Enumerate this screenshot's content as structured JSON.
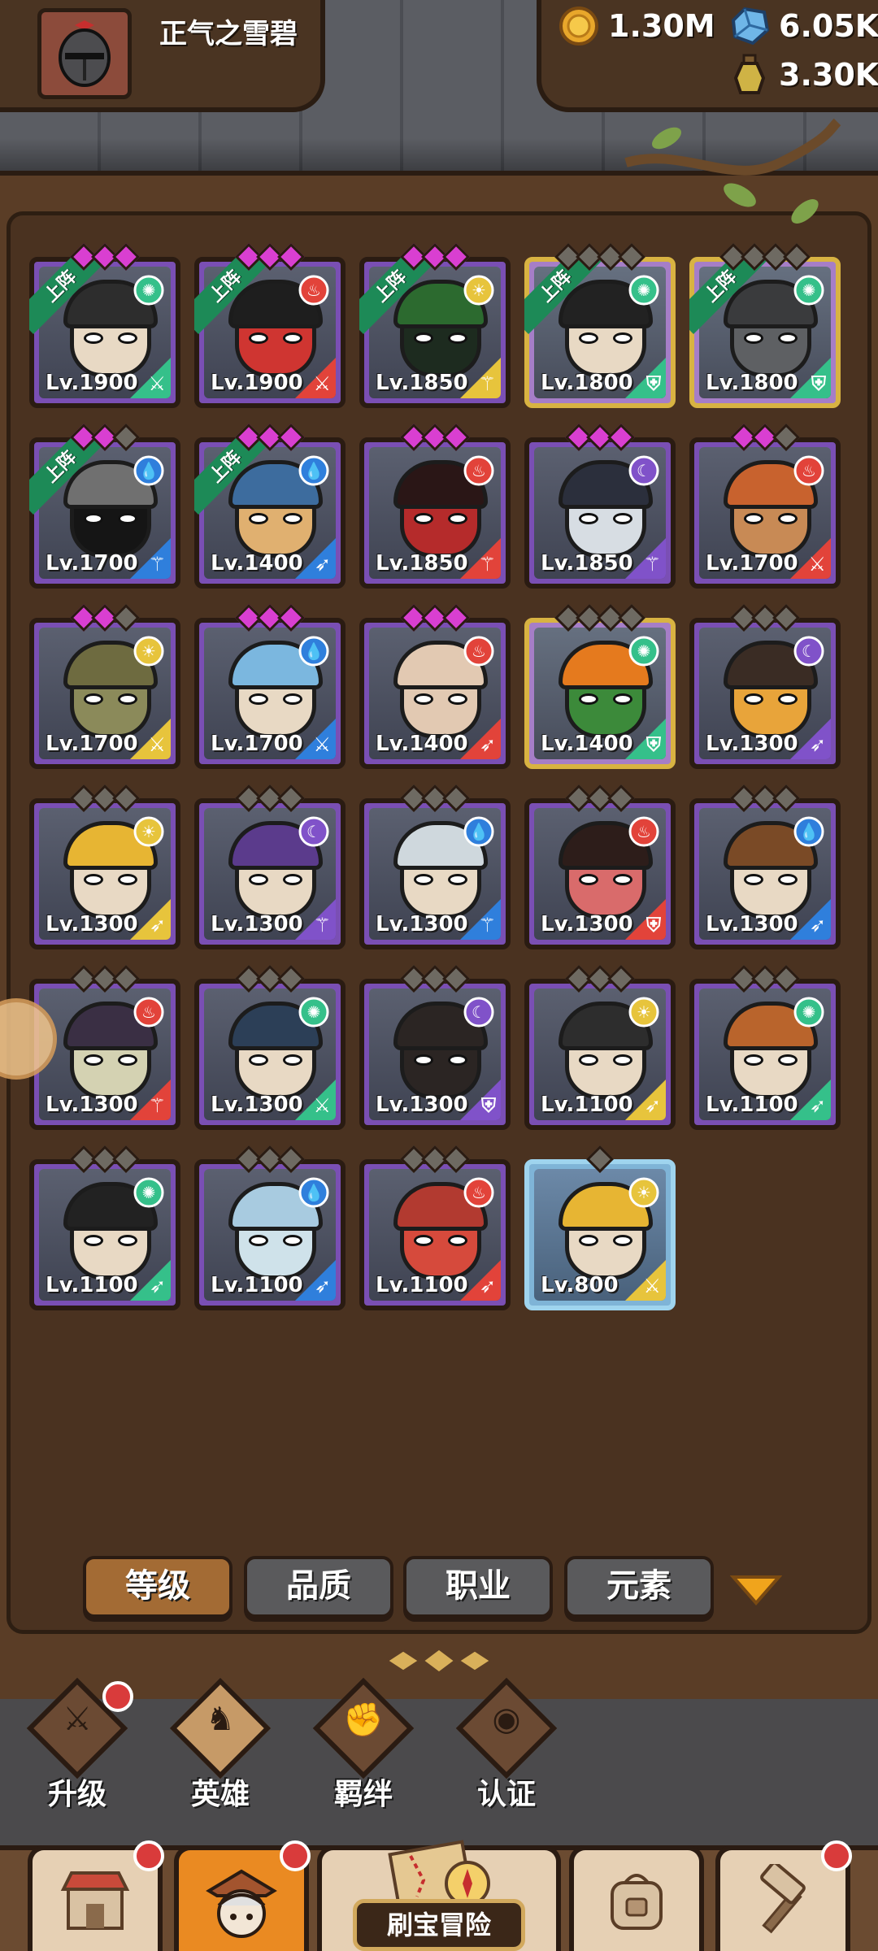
{
  "player": {
    "name": "正气之雪碧"
  },
  "resources": {
    "gold": "1.30M",
    "gems": "6.05K",
    "potion": "3.30K"
  },
  "ribbon_label": "上阵",
  "heroes": [
    {
      "level": "Lv.1900",
      "frame": "purple",
      "stars_on": 3,
      "stars_total": 3,
      "deployed": true,
      "element": "wind",
      "class": "sword",
      "face": "#e8d9c4",
      "hair": "#2d2d2d"
    },
    {
      "level": "Lv.1900",
      "frame": "purple",
      "stars_on": 3,
      "stars_total": 3,
      "deployed": true,
      "element": "fire",
      "class": "sword",
      "face": "#cf3531",
      "hair": "#1e1e1e"
    },
    {
      "level": "Lv.1850",
      "frame": "purple",
      "stars_on": 3,
      "stars_total": 3,
      "deployed": true,
      "element": "light",
      "class": "staff",
      "face": "#1d2b1f",
      "hair": "#2c6a2f"
    },
    {
      "level": "Lv.1800",
      "frame": "gold",
      "stars_on": 0,
      "stars_total": 4,
      "deployed": true,
      "element": "wind",
      "class": "shield",
      "face": "#e8d9c4",
      "hair": "#222"
    },
    {
      "level": "Lv.1800",
      "frame": "gold",
      "stars_on": 0,
      "stars_total": 4,
      "deployed": true,
      "element": "wind",
      "class": "shield",
      "face": "#5e6063",
      "hair": "#3a3b3d"
    },
    {
      "level": "Lv.1700",
      "frame": "purple",
      "stars_on": 2,
      "stars_total": 3,
      "deployed": true,
      "element": "water",
      "class": "staff",
      "face": "#151515",
      "hair": "#707070"
    },
    {
      "level": "Lv.1400",
      "frame": "purple",
      "stars_on": 3,
      "stars_total": 3,
      "deployed": true,
      "element": "water",
      "class": "bow",
      "face": "#e0b070",
      "hair": "#3d6c9e"
    },
    {
      "level": "Lv.1850",
      "frame": "purple",
      "stars_on": 3,
      "stars_total": 3,
      "deployed": false,
      "element": "fire",
      "class": "staff",
      "face": "#b52b2b",
      "hair": "#2a1616"
    },
    {
      "level": "Lv.1850",
      "frame": "purple",
      "stars_on": 3,
      "stars_total": 3,
      "deployed": false,
      "element": "dark",
      "class": "staff",
      "face": "#d7dde3",
      "hair": "#2b2f3c"
    },
    {
      "level": "Lv.1700",
      "frame": "purple",
      "stars_on": 2,
      "stars_total": 3,
      "deployed": false,
      "element": "fire",
      "class": "sword",
      "face": "#c88a55",
      "hair": "#c8622e"
    },
    {
      "level": "Lv.1700",
      "frame": "purple",
      "stars_on": 2,
      "stars_total": 3,
      "deployed": false,
      "element": "light",
      "class": "sword",
      "face": "#8b8a5a",
      "hair": "#6e6b40"
    },
    {
      "level": "Lv.1700",
      "frame": "purple",
      "stars_on": 3,
      "stars_total": 3,
      "deployed": false,
      "element": "water",
      "class": "sword",
      "face": "#e8d9c4",
      "hair": "#7bb7df"
    },
    {
      "level": "Lv.1400",
      "frame": "purple",
      "stars_on": 3,
      "stars_total": 3,
      "deployed": false,
      "element": "fire",
      "class": "bow",
      "face": "#e2c9b2",
      "hair": "#e2c9b2"
    },
    {
      "level": "Lv.1400",
      "frame": "gold",
      "stars_on": 0,
      "stars_total": 4,
      "deployed": false,
      "element": "wind",
      "class": "shield",
      "face": "#3c8a3a",
      "hair": "#e57a1e"
    },
    {
      "level": "Lv.1300",
      "frame": "purple",
      "stars_on": 0,
      "stars_total": 3,
      "deployed": false,
      "element": "dark",
      "class": "bow",
      "face": "#e8a43a",
      "hair": "#3a2c24"
    },
    {
      "level": "Lv.1300",
      "frame": "purple",
      "stars_on": 0,
      "stars_total": 3,
      "deployed": false,
      "element": "light",
      "class": "bow",
      "face": "#e8d9c4",
      "hair": "#e7b533"
    },
    {
      "level": "Lv.1300",
      "frame": "purple",
      "stars_on": 0,
      "stars_total": 3,
      "deployed": false,
      "element": "dark",
      "class": "staff",
      "face": "#e8d9c4",
      "hair": "#5b3b8c"
    },
    {
      "level": "Lv.1300",
      "frame": "purple",
      "stars_on": 0,
      "stars_total": 3,
      "deployed": false,
      "element": "water",
      "class": "staff",
      "face": "#e8d9c4",
      "hair": "#cfd8dd"
    },
    {
      "level": "Lv.1300",
      "frame": "purple",
      "stars_on": 0,
      "stars_total": 3,
      "deployed": false,
      "element": "fire",
      "class": "shield",
      "face": "#d96b6b",
      "hair": "#2d1d1a"
    },
    {
      "level": "Lv.1300",
      "frame": "purple",
      "stars_on": 0,
      "stars_total": 3,
      "deployed": false,
      "element": "water",
      "class": "bow",
      "face": "#e8d9c4",
      "hair": "#7a4a26"
    },
    {
      "level": "Lv.1300",
      "frame": "purple",
      "stars_on": 0,
      "stars_total": 3,
      "deployed": false,
      "element": "fire",
      "class": "staff",
      "face": "#d4d2b2",
      "hair": "#3a2f44"
    },
    {
      "level": "Lv.1300",
      "frame": "purple",
      "stars_on": 0,
      "stars_total": 3,
      "deployed": false,
      "element": "wind",
      "class": "sword",
      "face": "#e8d9c4",
      "hair": "#2c3f57"
    },
    {
      "level": "Lv.1300",
      "frame": "purple",
      "stars_on": 0,
      "stars_total": 3,
      "deployed": false,
      "element": "dark",
      "class": "shield",
      "face": "#2b2523",
      "hair": "#2b2523"
    },
    {
      "level": "Lv.1100",
      "frame": "purple",
      "stars_on": 0,
      "stars_total": 3,
      "deployed": false,
      "element": "light",
      "class": "bow",
      "face": "#e8d9c4",
      "hair": "#2d2d2d"
    },
    {
      "level": "Lv.1100",
      "frame": "purple",
      "stars_on": 0,
      "stars_total": 3,
      "deployed": false,
      "element": "wind",
      "class": "bow",
      "face": "#e8d9c4",
      "hair": "#b9642c"
    },
    {
      "level": "Lv.1100",
      "frame": "purple",
      "stars_on": 0,
      "stars_total": 3,
      "deployed": false,
      "element": "wind",
      "class": "bow",
      "face": "#e8d9c4",
      "hair": "#222"
    },
    {
      "level": "Lv.1100",
      "frame": "purple",
      "stars_on": 0,
      "stars_total": 3,
      "deployed": false,
      "element": "water",
      "class": "bow",
      "face": "#cfe2ea",
      "hair": "#a8cbe0"
    },
    {
      "level": "Lv.1100",
      "frame": "purple",
      "stars_on": 0,
      "stars_total": 3,
      "deployed": false,
      "element": "fire",
      "class": "bow",
      "face": "#d64a3c",
      "hair": "#b23a30"
    },
    {
      "level": "Lv.800",
      "frame": "blue",
      "stars_on": 0,
      "stars_total": 1,
      "deployed": false,
      "element": "light",
      "class": "sword",
      "face": "#e8d9c4",
      "hair": "#e7b533"
    }
  ],
  "sort_tabs": [
    "等级",
    "品质",
    "职业",
    "元素"
  ],
  "sub_nav": [
    {
      "label": "升级",
      "icon": "sword-icon",
      "badge": true
    },
    {
      "label": "英雄",
      "icon": "hero-icon",
      "badge": false
    },
    {
      "label": "羁绊",
      "icon": "handshake-icon",
      "badge": false
    },
    {
      "label": "认证",
      "icon": "eye-icon",
      "badge": false
    }
  ],
  "bottom_tabs": [
    {
      "icon": "shop-icon",
      "badge": true
    },
    {
      "icon": "hero-portrait-icon",
      "badge": true
    },
    {
      "label": "刷宝冒险",
      "icon": "treasure-map-icon",
      "badge": false
    },
    {
      "icon": "backpack-icon",
      "badge": false
    },
    {
      "icon": "hammer-icon",
      "badge": true
    }
  ],
  "colors": {
    "frame_purple": "#7a4fb4",
    "frame_gold": "#d8b342",
    "frame_blue": "#9fd4ee",
    "elem_wind": "#35c08a",
    "elem_fire": "#e2433a",
    "elem_light": "#e7c43c",
    "elem_water": "#2f7fdc",
    "elem_dark": "#8052c9",
    "badge": "#d93b3b",
    "sort_active": "#a36b34"
  }
}
